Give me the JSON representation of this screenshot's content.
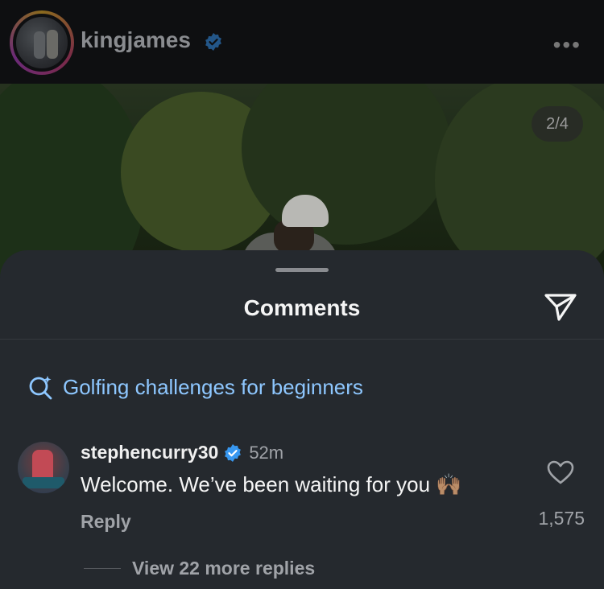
{
  "post": {
    "username": "kingjames",
    "more_icon": "more-horizontal-icon",
    "page_indicator": "2/4"
  },
  "comments_sheet": {
    "title": "Comments",
    "share_icon": "send-icon",
    "search_suggestion": "Golfing challenges for beginners",
    "comment": {
      "username": "stephencurry30",
      "time": "52m",
      "text": "Welcome. We’ve been waiting for you 🙌🏽",
      "reply_label": "Reply",
      "like_count": "1,575"
    },
    "view_replies_label": "View 22 more replies"
  },
  "colors": {
    "verified": "#3797f0",
    "link": "#8ec7ff",
    "sheet_bg": "#25292e"
  }
}
